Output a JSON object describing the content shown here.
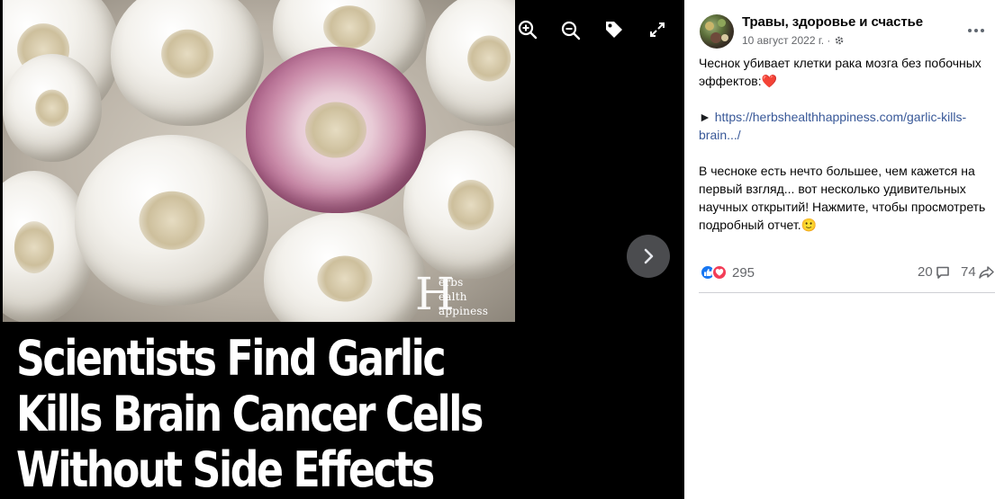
{
  "viewer": {
    "headline_lines": [
      "Scientists Find Garlic",
      "Kills Brain Cancer Cells",
      "Without Side Effects"
    ],
    "watermark": {
      "letter": "H",
      "line1": "erbs",
      "line2": "ealth",
      "line3": "appiness"
    },
    "toolbar": {
      "zoom_in_icon": "zoom-in-icon",
      "zoom_out_icon": "zoom-out-icon",
      "tag_icon": "tag-icon",
      "fullscreen_icon": "fullscreen-icon"
    },
    "next_icon": "chevron-right-icon"
  },
  "post": {
    "page_name": "Травы, здоровье и счастье",
    "date": "10 август 2022 г. ·",
    "audience_icon": "public-gear-icon",
    "text": {
      "line1": "Чеснок убивает клетки рака мозга без побочных эффектов:❤️",
      "link_prefix": "► ",
      "link": "https://herbshealthhappiness.com/garlic-kills-brain.../",
      "line3": "В чесноке есть нечто большее, чем кажется на первый взгляд... вот несколько удивительных научных открытий! Нажмите, чтобы просмотреть подробный отчет.🙂"
    },
    "reactions": {
      "count": "295",
      "types": [
        "like",
        "love"
      ]
    },
    "comments_count": "20",
    "shares_count": "74"
  },
  "colors": {
    "link": "#385898",
    "secondary_text": "#65676b",
    "like": "#1877f2",
    "love": "#f33e58"
  }
}
